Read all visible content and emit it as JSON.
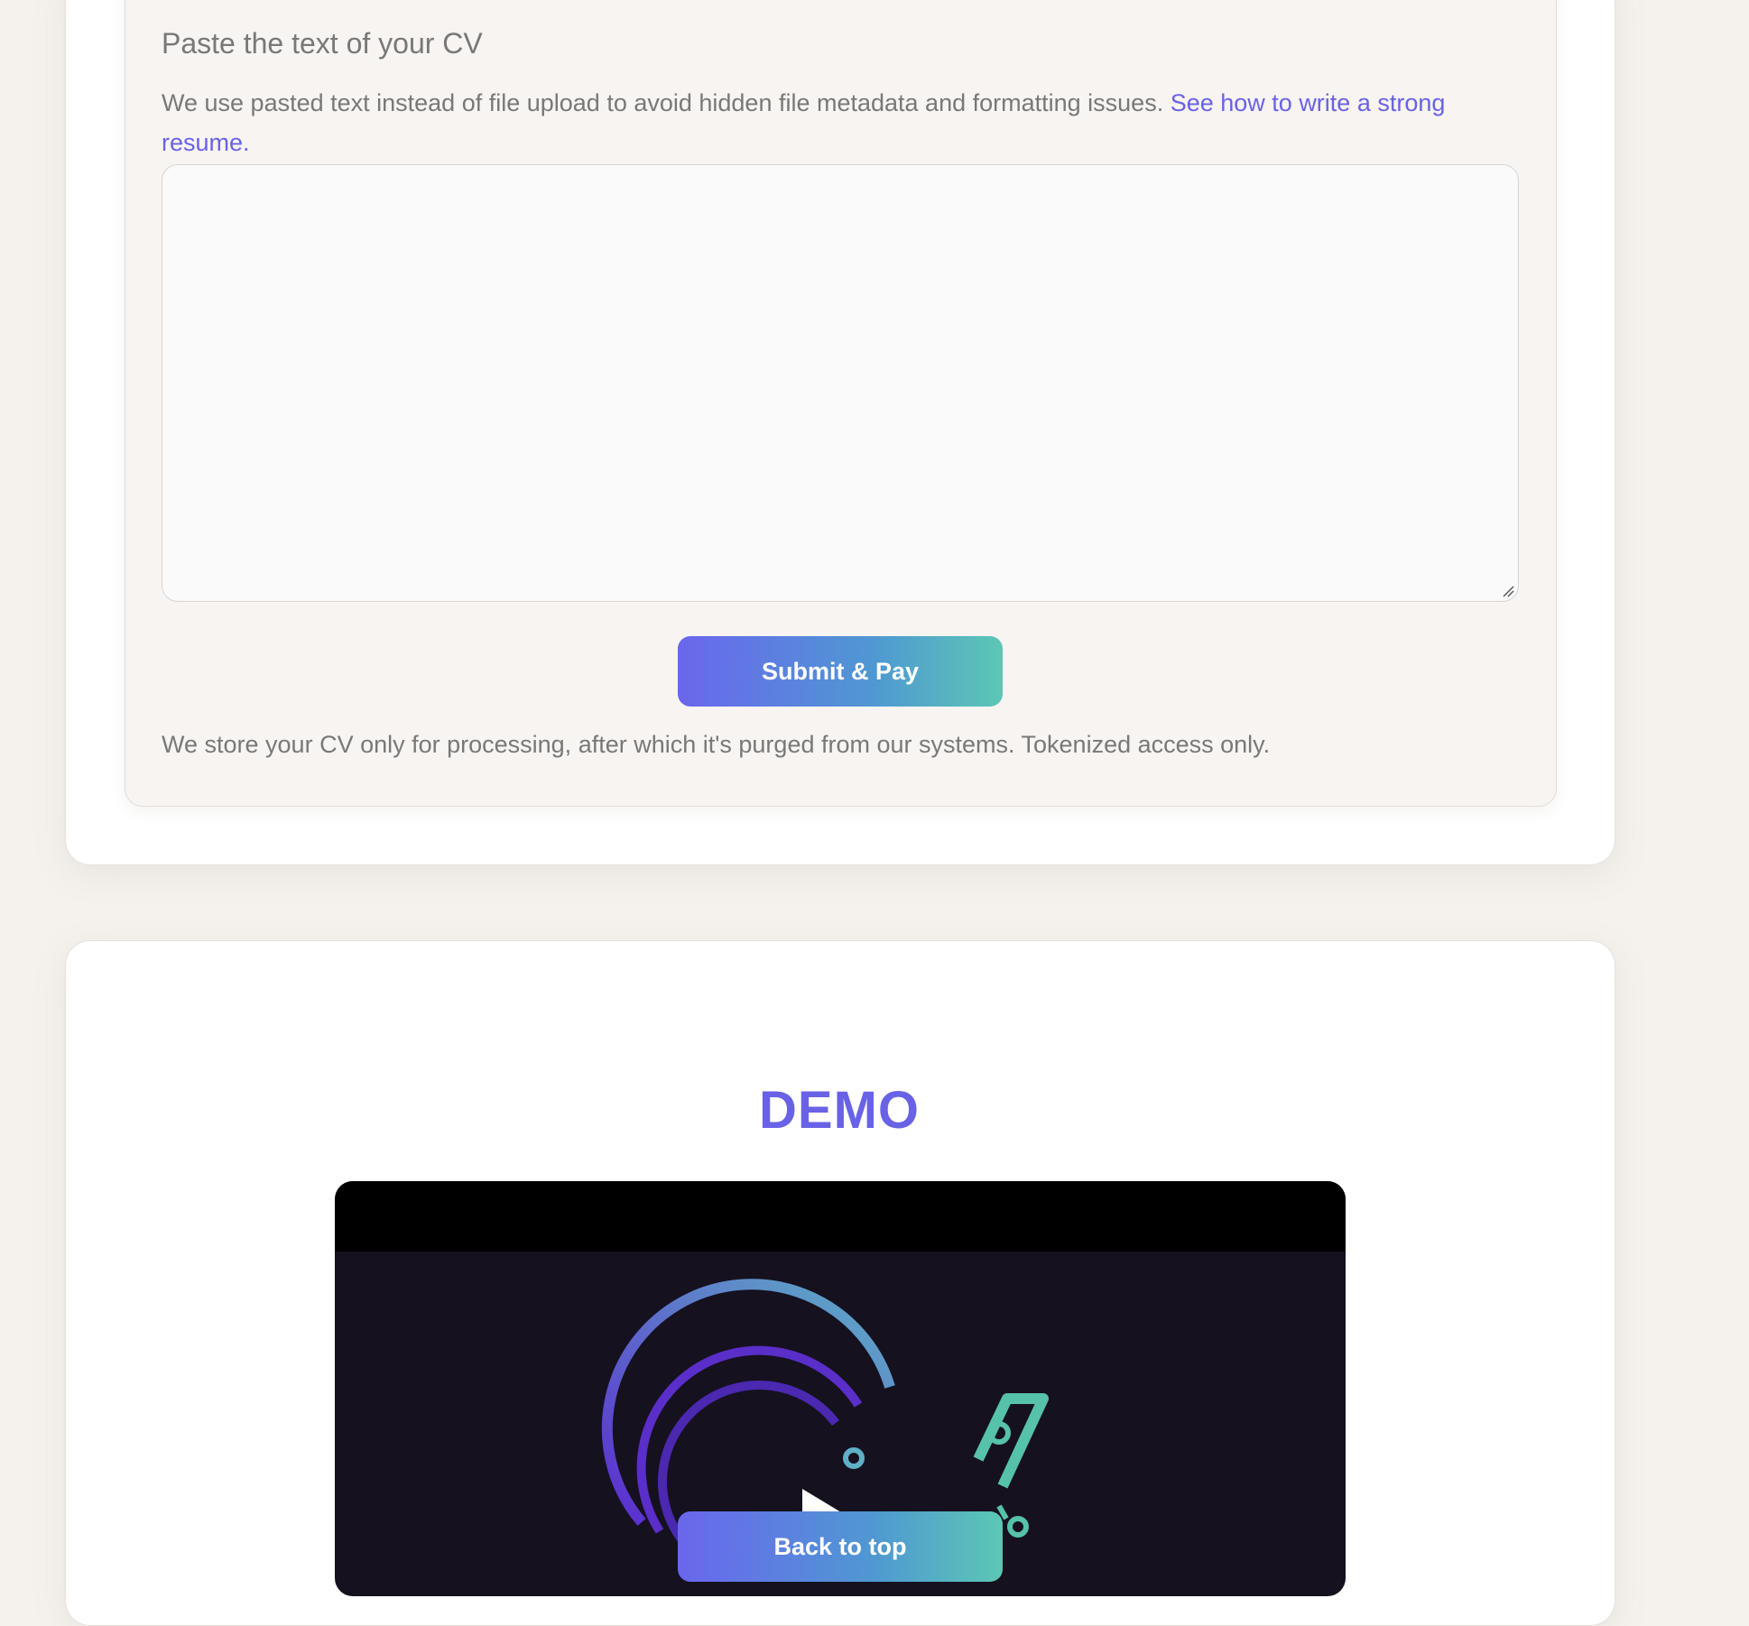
{
  "form": {
    "label": "Paste the text of your CV",
    "note": "We use pasted text instead of file upload to avoid hidden file metadata and formatting issues.",
    "note_link": "See how to write a strong resume.",
    "textarea_value": "",
    "submit_label": "Submit & Pay",
    "privacy": "We store your CV only for processing, after which it's purged from our systems. Tokenized access only."
  },
  "demo": {
    "title": "DEMO",
    "play_icon": "play-icon"
  },
  "back_to_top_label": "Back to top",
  "colors": {
    "accent": "#6962e6",
    "gradient_start": "#6a66ee",
    "gradient_end": "#5cc7b5",
    "page_bg": "#f5f2ee"
  }
}
